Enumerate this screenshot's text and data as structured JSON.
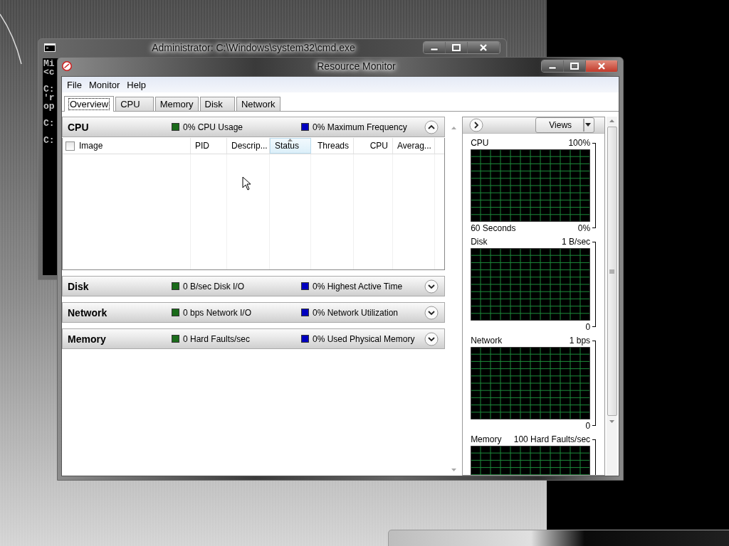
{
  "console_window": {
    "title": "Administrator: C:\\Windows\\system32\\cmd.exe",
    "paragraphs": [
      [
        "Mi",
        "<c"
      ],
      [
        "C:",
        "'r",
        "op"
      ],
      [
        "C:"
      ],
      [
        "C:"
      ]
    ]
  },
  "resource_monitor": {
    "title": "Resource Monitor",
    "menu": [
      "File",
      "Monitor",
      "Help"
    ],
    "tabs": [
      {
        "label": "Overview",
        "selected": true
      },
      {
        "label": "CPU",
        "selected": false
      },
      {
        "label": "Memory",
        "selected": false
      },
      {
        "label": "Disk",
        "selected": false
      },
      {
        "label": "Network",
        "selected": false
      }
    ],
    "sections": [
      {
        "title": "CPU",
        "expanded": true,
        "metrics": [
          {
            "text": "0% CPU Usage",
            "color": "#1a6b1a"
          },
          {
            "text": "0% Maximum Frequency",
            "color": "#0000c0"
          }
        ],
        "table": {
          "select_all": {
            "checked": false
          },
          "columns": [
            {
              "label": "Image",
              "sorted": false
            },
            {
              "label": "PID",
              "sorted": false
            },
            {
              "label": "Descrip...",
              "sorted": false
            },
            {
              "label": "Status",
              "sorted": true
            },
            {
              "label": "Threads",
              "sorted": false
            },
            {
              "label": "CPU",
              "sorted": false
            },
            {
              "label": "Averag...",
              "sorted": false
            }
          ]
        }
      },
      {
        "title": "Disk",
        "expanded": false,
        "metrics": [
          {
            "text": "0 B/sec Disk I/O",
            "color": "#1a6b1a"
          },
          {
            "text": "0% Highest Active Time",
            "color": "#0000c0"
          }
        ]
      },
      {
        "title": "Network",
        "expanded": false,
        "metrics": [
          {
            "text": "0 bps Network I/O",
            "color": "#1a6b1a"
          },
          {
            "text": "0% Network Utilization",
            "color": "#0000c0"
          }
        ]
      },
      {
        "title": "Memory",
        "expanded": false,
        "metrics": [
          {
            "text": "0 Hard Faults/sec",
            "color": "#1a6b1a"
          },
          {
            "text": "0% Used Physical Memory",
            "color": "#0000c0"
          }
        ]
      }
    ],
    "side_panel": {
      "views_button": "Views",
      "graphs": [
        {
          "title": "CPU",
          "scale_max": "100%",
          "footer_left": "60 Seconds",
          "scale_min": "0%"
        },
        {
          "title": "Disk",
          "scale_max": "1 B/sec",
          "scale_min": "0"
        },
        {
          "title": "Network",
          "scale_max": "1 bps",
          "scale_min": "0"
        },
        {
          "title": "Memory",
          "scale_max": "100 Hard Faults/sec"
        }
      ]
    }
  }
}
